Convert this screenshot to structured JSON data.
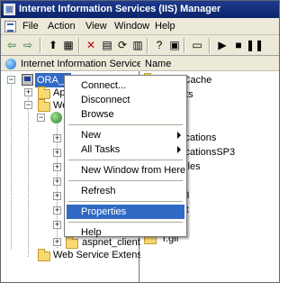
{
  "window": {
    "title": "Internet Information Services (IIS) Manager"
  },
  "menubar": {
    "items": [
      "File",
      "Action",
      "View",
      "Window",
      "Help"
    ]
  },
  "toolbar": {
    "buttons": [
      {
        "name": "back-icon",
        "glyph": "⇦"
      },
      {
        "name": "forward-icon",
        "glyph": "⇨"
      },
      {
        "name": "up-folder-icon",
        "glyph": "⬆"
      },
      {
        "name": "show-hide-tree-icon",
        "glyph": "▦"
      },
      {
        "name": "delete-icon",
        "glyph": "✕"
      },
      {
        "name": "properties-icon",
        "glyph": "▤"
      },
      {
        "name": "refresh-icon",
        "glyph": "⟳"
      },
      {
        "name": "export-list-icon",
        "glyph": "▥"
      },
      {
        "name": "help-icon",
        "glyph": "?"
      },
      {
        "name": "view-icon",
        "glyph": "▣"
      },
      {
        "name": "computer-icon",
        "glyph": "▭"
      },
      {
        "name": "start-icon",
        "glyph": "▶"
      },
      {
        "name": "stop-icon",
        "glyph": "■"
      },
      {
        "name": "pause-icon",
        "glyph": "❚❚"
      }
    ]
  },
  "tree": {
    "header": "Internet Information Services",
    "server": "ORA_APP_TEST (local computer)",
    "app_pools_partial": "App",
    "web_sites_partial": "Web",
    "aspnet_client": "aspnet_client",
    "web_service_ext": "Web Service Extension"
  },
  "list": {
    "header": "Name",
    "items": [
      "NextCache",
      "Scripts",
      "ology",
      "ache",
      "Applications",
      "ApplicationsSP3",
      "Modules",
      "ts",
      "tsSP3",
      ".client",
      "htm",
      "r.gif"
    ]
  },
  "context_menu": {
    "items": [
      {
        "label": "Connect...",
        "type": "item"
      },
      {
        "label": "Disconnect",
        "type": "item"
      },
      {
        "label": "Browse",
        "type": "item"
      },
      {
        "type": "separator"
      },
      {
        "label": "New",
        "type": "submenu"
      },
      {
        "label": "All Tasks",
        "type": "submenu"
      },
      {
        "type": "separator"
      },
      {
        "label": "New Window from Here",
        "type": "item"
      },
      {
        "type": "separator"
      },
      {
        "label": "Refresh",
        "type": "item"
      },
      {
        "type": "separator"
      },
      {
        "label": "Properties",
        "type": "item",
        "selected": true
      },
      {
        "type": "separator"
      },
      {
        "label": "Help",
        "type": "item"
      }
    ]
  },
  "colors": {
    "title_bar": "#0a246a",
    "selection": "#316ac5",
    "folder": "#f7d872"
  }
}
